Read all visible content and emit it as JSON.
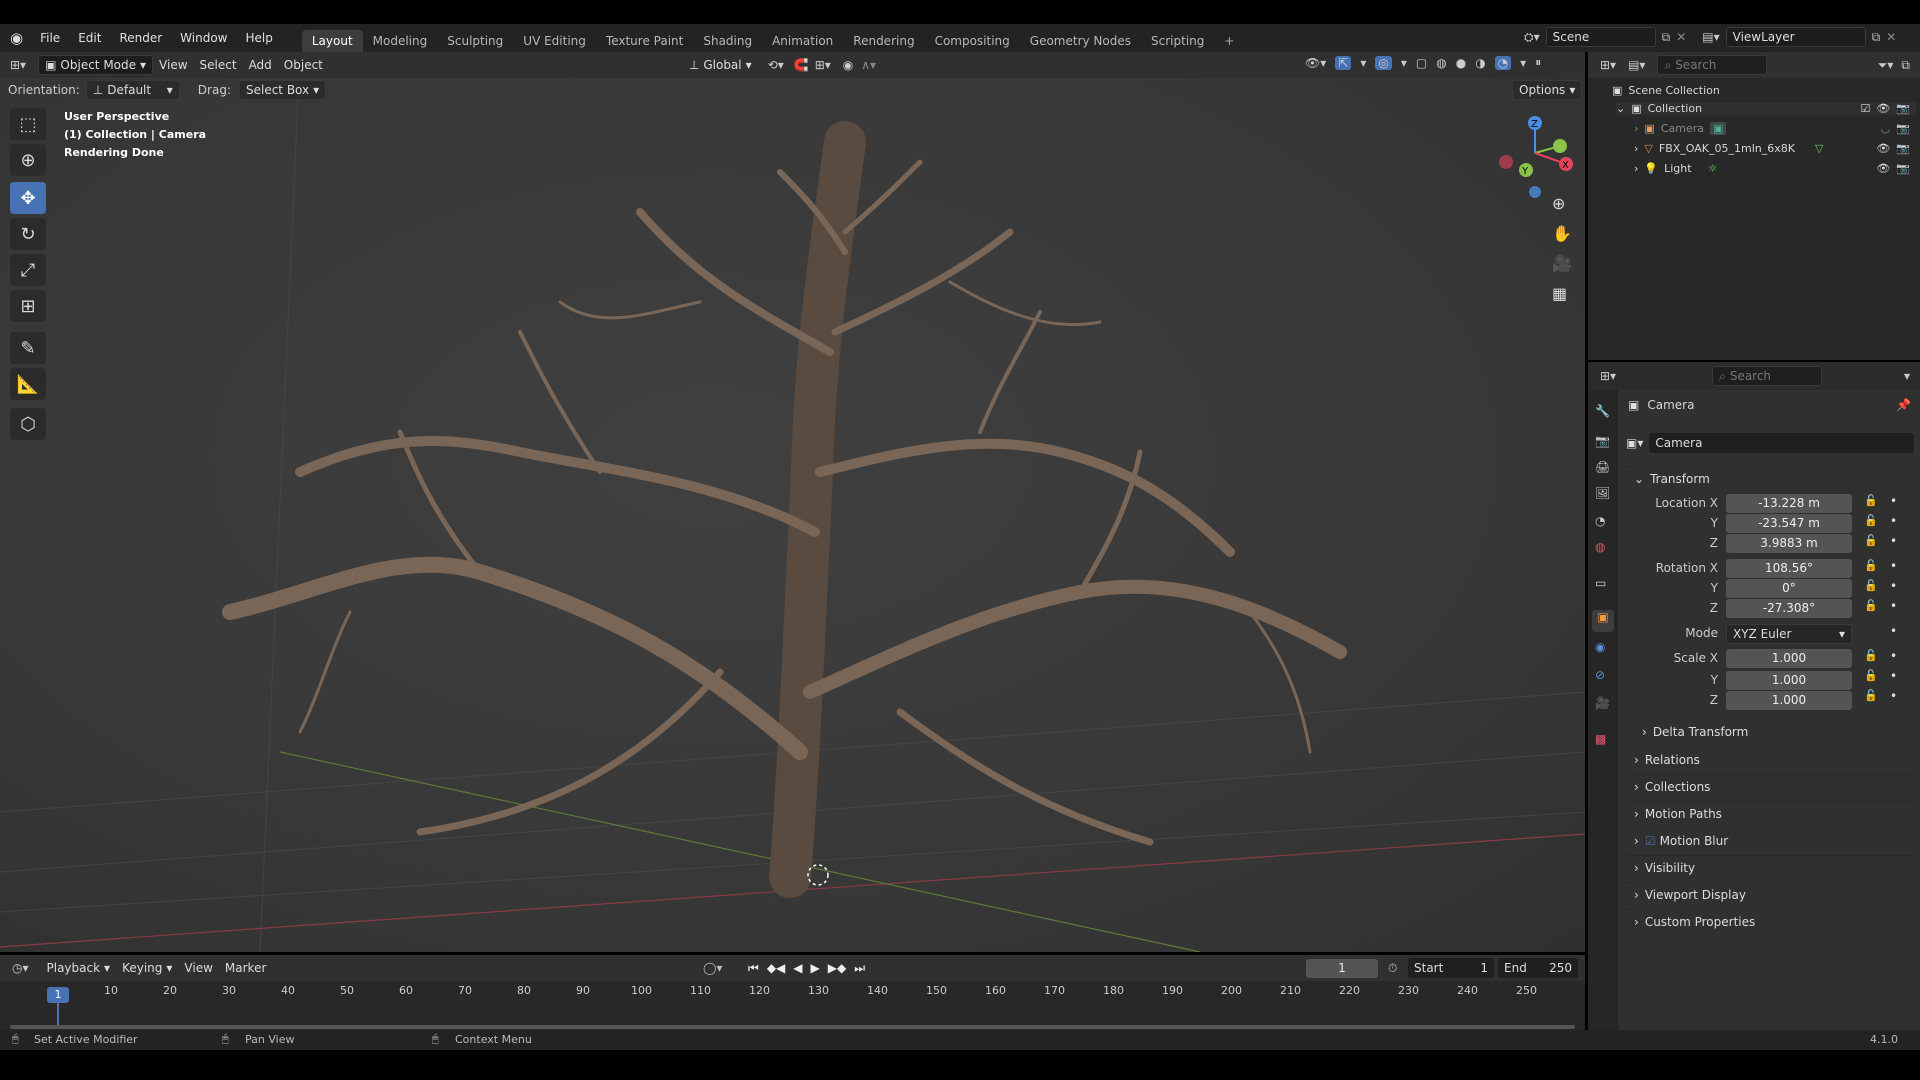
{
  "topbar": {
    "menus": [
      "File",
      "Edit",
      "Render",
      "Window",
      "Help"
    ],
    "workspaces": [
      "Layout",
      "Modeling",
      "Sculpting",
      "UV Editing",
      "Texture Paint",
      "Shading",
      "Animation",
      "Rendering",
      "Compositing",
      "Geometry Nodes",
      "Scripting"
    ],
    "active_workspace": "Layout",
    "add_tab": "+",
    "scene": "Scene",
    "view_layer": "ViewLayer"
  },
  "viewport_header": {
    "mode": "Object Mode",
    "menus": [
      "View",
      "Select",
      "Add",
      "Object"
    ],
    "transform_orientation": "Global",
    "orientation_label": "Orientation:",
    "orientation_value": "Default",
    "drag_label": "Drag:",
    "drag_value": "Select Box",
    "options": "Options"
  },
  "viewport": {
    "overlay_lines": [
      "User Perspective",
      "(1) Collection | Camera",
      "Rendering Done"
    ],
    "gizmo_axes": [
      "X",
      "Y",
      "Z"
    ]
  },
  "outliner": {
    "search_placeholder": "Search",
    "scene_collection": "Scene Collection",
    "collection": "Collection",
    "items": [
      "Camera",
      "FBX_OAK_05_1mln_6x8K",
      "Light"
    ]
  },
  "properties": {
    "search_placeholder": "Search",
    "context": "Camera",
    "object_name": "Camera",
    "transform_title": "Transform",
    "location_label": "Location X",
    "location": [
      "-13.228 m",
      "-23.547 m",
      "3.9883 m"
    ],
    "rotation_label": "Rotation X",
    "rotation": [
      "108.56°",
      "0°",
      "-27.308°"
    ],
    "mode_label": "Mode",
    "mode": "XYZ Euler",
    "scale_label": "Scale X",
    "scale": [
      "1.000",
      "1.000",
      "1.000"
    ],
    "axis_labels": [
      "Y",
      "Z"
    ],
    "delta_transform": "Delta Transform",
    "sections": [
      "Relations",
      "Collections",
      "Motion Paths",
      "Motion Blur",
      "Visibility",
      "Viewport Display",
      "Custom Properties"
    ]
  },
  "timeline": {
    "menus": [
      "Playback",
      "Keying",
      "View",
      "Marker"
    ],
    "current_frame": "1",
    "start_label": "Start",
    "start": "1",
    "end_label": "End",
    "end": "250",
    "ticks": [
      "1",
      "10",
      "20",
      "30",
      "40",
      "50",
      "60",
      "70",
      "80",
      "90",
      "100",
      "110",
      "120",
      "130",
      "140",
      "150",
      "160",
      "170",
      "180",
      "190",
      "200",
      "210",
      "220",
      "230",
      "240",
      "250"
    ]
  },
  "statusbar": {
    "hints": [
      "Set Active Modifier",
      "Pan View",
      "Context Menu"
    ],
    "version": "4.1.0"
  },
  "colors": {
    "accent": "#4772b3",
    "background": "#3a3a3a",
    "panel": "#303030",
    "axis_x": "#e5435c",
    "axis_y": "#8bc34a",
    "axis_z": "#4a8fe0"
  }
}
